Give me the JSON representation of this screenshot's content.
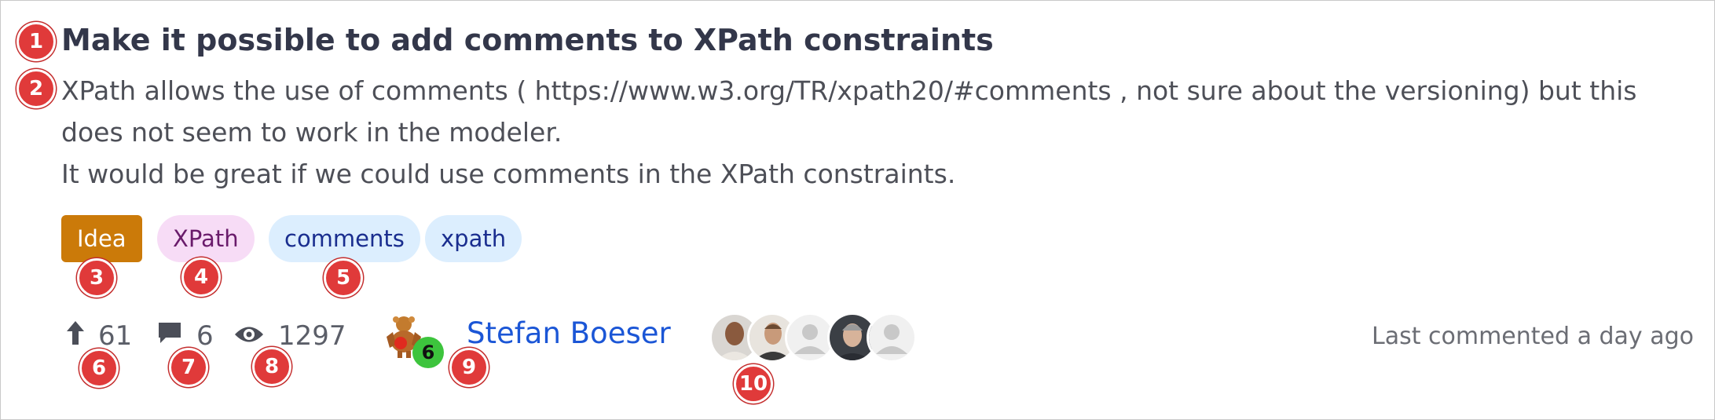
{
  "post": {
    "title": "Make it possible to add comments to XPath constraints",
    "body": [
      "XPath allows the use of comments ( https://www.w3.org/TR/xpath20/#comments , not sure about the versioning)  but this",
      "does not seem to work in the modeler.",
      "It would be great if we could use comments in the XPath constraints."
    ],
    "tags": [
      "Idea",
      "XPath",
      "comments",
      "xpath"
    ]
  },
  "stats": {
    "upvotes": "61",
    "comments": "6",
    "views": "1297"
  },
  "author": {
    "name": "Stefan Boeser",
    "badge": "6"
  },
  "participants": [
    {
      "kind": "photo",
      "icon": "participant-avatar-1"
    },
    {
      "kind": "photo",
      "icon": "participant-avatar-2"
    },
    {
      "kind": "placeholder",
      "icon": "default-user-avatar"
    },
    {
      "kind": "photo",
      "icon": "participant-avatar-4"
    },
    {
      "kind": "placeholder",
      "icon": "default-user-avatar"
    }
  ],
  "activity": {
    "last_commented": "Last commented a day ago"
  },
  "markers": [
    "1",
    "2",
    "3",
    "4",
    "5",
    "6",
    "7",
    "8",
    "9",
    "10"
  ],
  "colors": {
    "idea_tag": "#cb7a09",
    "xpath_tag_bg": "#f7dcf6",
    "topic_tag_bg": "#dceefe",
    "link": "#1b56d6",
    "marker": "#e03a3a",
    "badge": "#3dc43d"
  }
}
